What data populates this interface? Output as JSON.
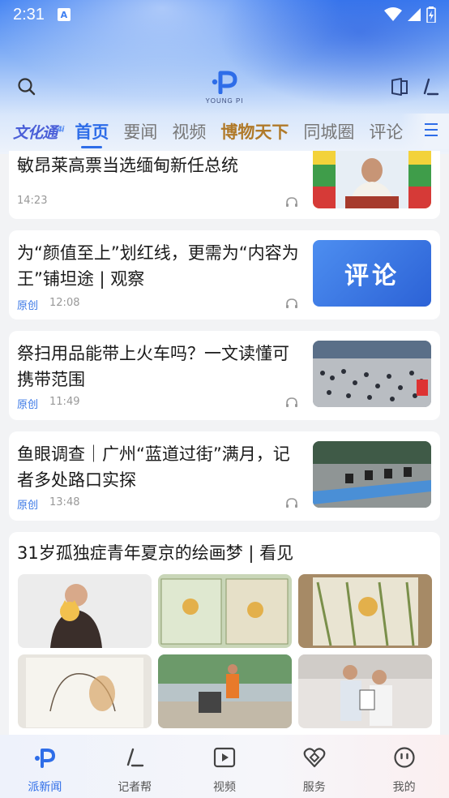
{
  "status": {
    "time": "2:31",
    "indicator": "A"
  },
  "header": {
    "logo_sub": "YOUNG PI"
  },
  "tabs": {
    "brand": "文化通",
    "brand_sup": "4i",
    "items": [
      "首页",
      "要闻",
      "视频",
      "博物天下",
      "同城圈",
      "评论"
    ],
    "active_index": 0
  },
  "feed": {
    "articles": [
      {
        "title": "敏昂莱高票当选缅甸新任总统",
        "tag": "",
        "time": "14:23"
      },
      {
        "title": "为“颜值至上”划红线，更需为“内容为王”铺坦途 | 观察",
        "tag": "原创",
        "time": "12:08",
        "thumb_text": "评论"
      },
      {
        "title": "祭扫用品能带上火车吗？一文读懂可携带范围",
        "tag": "原创",
        "time": "11:49"
      },
      {
        "title": "鱼眼调查｜广州“蓝道过街”满月，记者多处路口实探",
        "tag": "原创",
        "time": "13:48"
      }
    ],
    "gallery": {
      "title": "31岁孤独症青年夏京的绘画梦 | 看见"
    }
  },
  "bottom_nav": {
    "items": [
      {
        "label": "派新闻",
        "icon": "pai-logo-icon"
      },
      {
        "label": "记者帮",
        "icon": "reporter-icon"
      },
      {
        "label": "视频",
        "icon": "play-icon"
      },
      {
        "label": "服务",
        "icon": "heart-service-icon"
      },
      {
        "label": "我的",
        "icon": "face-icon"
      }
    ],
    "active_index": 0
  },
  "colors": {
    "accent": "#2e6de8",
    "orig_tag": "#3b78e6"
  }
}
